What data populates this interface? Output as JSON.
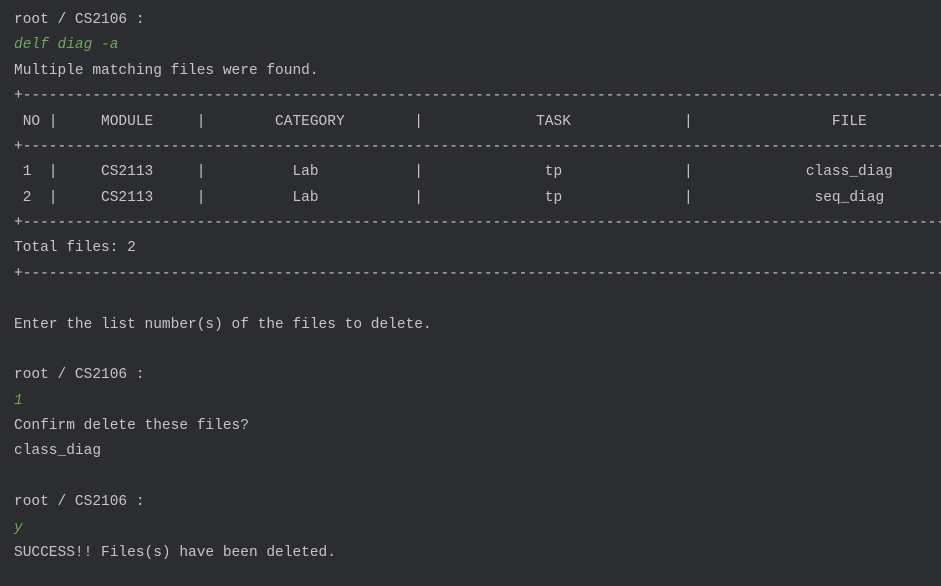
{
  "prompts": {
    "p1": "root / CS2106 :",
    "p2": "root / CS2106 :",
    "p3": "root / CS2106 :"
  },
  "inputs": {
    "cmd1": "delf diag -a",
    "cmd2": "1",
    "cmd3": "y"
  },
  "messages": {
    "multi_match": "Multiple matching files were found.",
    "enter_list": "Enter the list number(s) of the files to delete.",
    "confirm": "Confirm delete these files?",
    "file_to_delete": "class_diag",
    "success": "SUCCESS!! Files(s) have been deleted."
  },
  "table": {
    "border_top": "+------------------------------------------------------------------------------------------------------------------+",
    "header": " NO |     MODULE     |        CATEGORY        |             TASK             |                FILE",
    "border_mid": "+------------------------------------------------------------------------------------------------------------------+",
    "row1": " 1  |     CS2113     |          Lab           |              tp              |             class_diag",
    "row2": " 2  |     CS2113     |          Lab           |              tp              |              seq_diag",
    "border_bot": "+------------------------------------------------------------------------------------------------------------------+",
    "total": "Total files: 2",
    "border_end": "+------------------------------------------------------------------------------------------------------------------+"
  },
  "chart_data": {
    "type": "table",
    "columns": [
      "NO",
      "MODULE",
      "CATEGORY",
      "TASK",
      "FILE"
    ],
    "rows": [
      {
        "NO": 1,
        "MODULE": "CS2113",
        "CATEGORY": "Lab",
        "TASK": "tp",
        "FILE": "class_diag"
      },
      {
        "NO": 2,
        "MODULE": "CS2113",
        "CATEGORY": "Lab",
        "TASK": "tp",
        "FILE": "seq_diag"
      }
    ],
    "total_files": 2
  }
}
